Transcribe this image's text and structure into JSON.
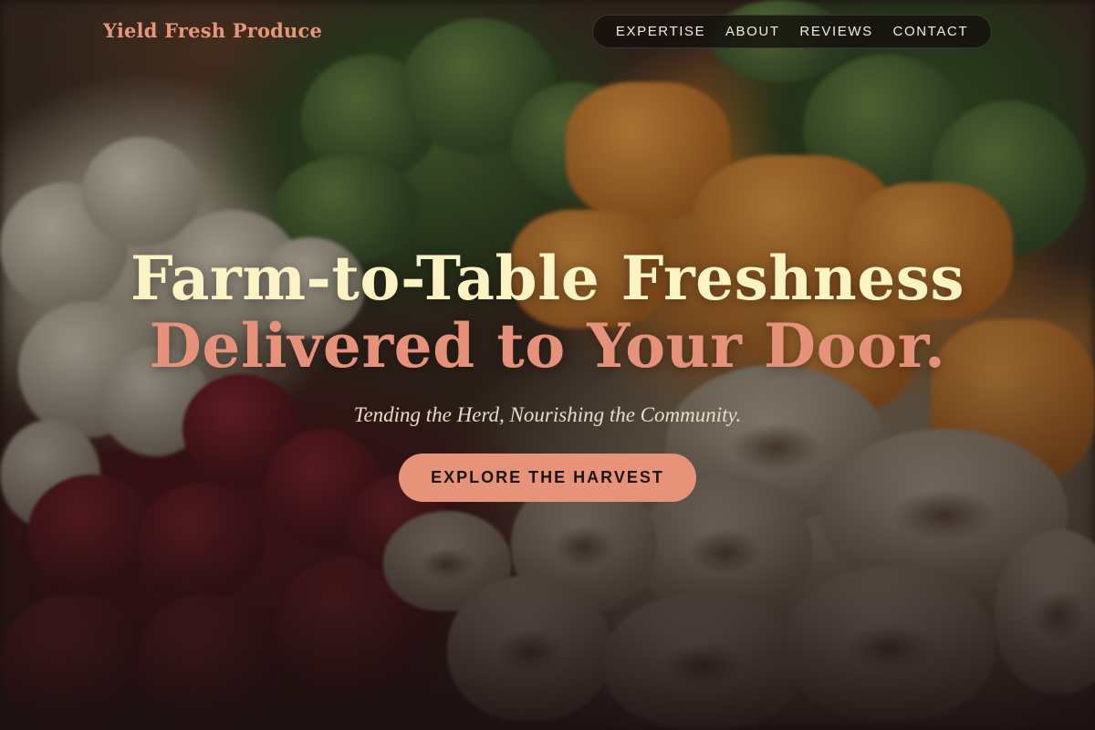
{
  "brand": {
    "name": "Yield Fresh Produce"
  },
  "nav": {
    "items": [
      {
        "label": "EXPERTISE"
      },
      {
        "label": "ABOUT"
      },
      {
        "label": "REVIEWS"
      },
      {
        "label": "CONTACT"
      }
    ]
  },
  "hero": {
    "headline_line1": "Farm-to-Table Freshness",
    "headline_line2": "Delivered to Your Door.",
    "tagline": "Tending the Herd, Nourishing the Community.",
    "cta_label": "EXPLORE THE HARVEST"
  },
  "colors": {
    "accent": "#e6937a",
    "headline_cream": "#fbf3c4",
    "nav_background": "#14100e"
  }
}
